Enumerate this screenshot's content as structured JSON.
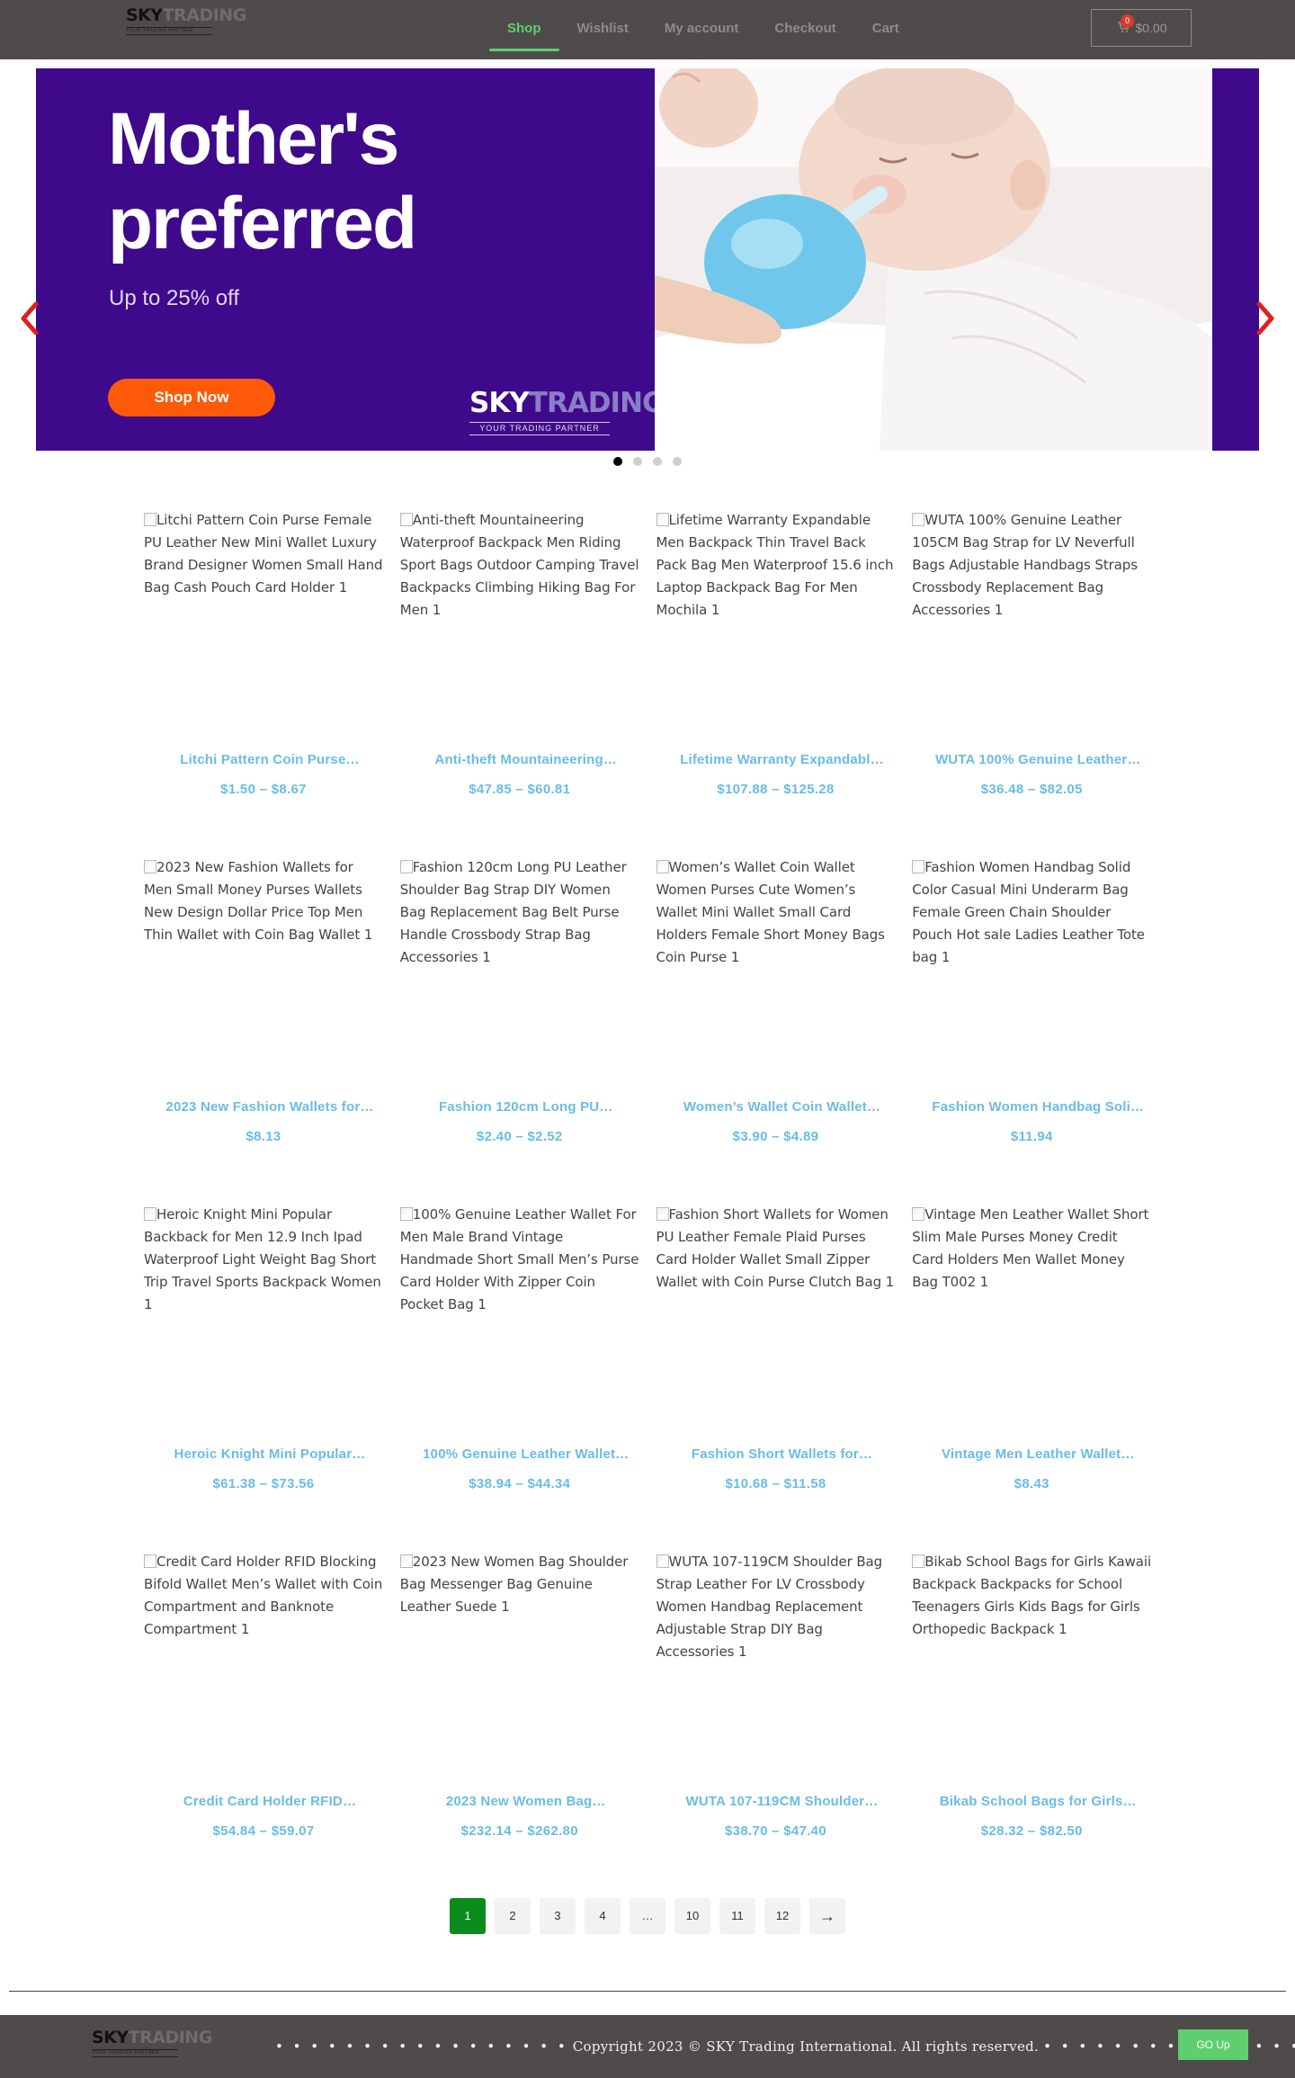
{
  "brand": {
    "logo_main": "SKY",
    "logo_accent": "TRADING",
    "logo_tagline": "YOUR TRADING PARTNER"
  },
  "nav": {
    "items": [
      {
        "label": "Shop",
        "active": true
      },
      {
        "label": "Wishlist",
        "active": false
      },
      {
        "label": "My account",
        "active": false
      },
      {
        "label": "Checkout",
        "active": false
      },
      {
        "label": "Cart",
        "active": false
      }
    ]
  },
  "cart": {
    "count": "0",
    "amount": "$0.00",
    "icon": "cart-icon"
  },
  "banner": {
    "headline_line1": "Mother's",
    "headline_line2": "preferred",
    "subline": "Up to 25% off",
    "cta": "Shop Now",
    "brand_main": "SKY",
    "brand_accent": "TRADING",
    "brand_tagline": "YOUR TRADING PARTNER",
    "background_color": "#3e098a",
    "slide_count": 4,
    "active_slide": 1
  },
  "products": [
    {
      "alt": "Litchi Pattern Coin Purse Female PU Leather New Mini Wallet Luxury Brand Designer Women Small Hand Bag Cash Pouch Card Holder 1",
      "title": "Litchi Pattern Coin Purse…",
      "price": "$1.50 – $8.67"
    },
    {
      "alt": "Anti-theft Mountaineering Waterproof Backpack Men Riding Sport Bags Outdoor Camping Travel Backpacks Climbing Hiking Bag For Men 1",
      "title": "Anti-theft Mountaineering…",
      "price": "$47.85 – $60.81"
    },
    {
      "alt": "Lifetime Warranty Expandable Men Backpack Thin Travel Back Pack Bag Men Waterproof 15.6 inch Laptop Backpack Bag For Men Mochila 1",
      "title": "Lifetime Warranty Expandabl…",
      "price": "$107.88 – $125.28"
    },
    {
      "alt": "WUTA 100% Genuine Leather 105CM Bag Strap for LV Neverfull Bags Adjustable Handbags Straps Crossbody Replacement Bag Accessories 1",
      "title": "WUTA 100% Genuine Leather…",
      "price": "$36.48 – $82.05"
    },
    {
      "alt": "2023 New Fashion Wallets for Men Small Money Purses Wallets New Design Dollar Price Top Men Thin Wallet with Coin Bag Wallet 1",
      "title": "2023 New Fashion Wallets for…",
      "price": "$8.13"
    },
    {
      "alt": "Fashion 120cm Long PU Leather Shoulder Bag Strap DIY Women Bag Replacement Bag Belt Purse Handle Crossbody Strap Bag Accessories 1",
      "title": "Fashion 120cm Long PU…",
      "price": "$2.40 – $2.52"
    },
    {
      "alt": "Women’s Wallet Coin Wallet Women Purses Cute Women’s Wallet Mini Wallet Small Card Holders Female Short Money Bags Coin Purse 1",
      "title": "Women’s Wallet Coin Wallet…",
      "price": "$3.90 – $4.89"
    },
    {
      "alt": "Fashion Women Handbag Solid Color Casual Mini Underarm Bag Female Green Chain Shoulder Pouch Hot sale Ladies Leather Tote bag 1",
      "title": "Fashion Women Handbag Soli…",
      "price": "$11.94"
    },
    {
      "alt": "Heroic Knight Mini Popular Backback for Men 12.9 Inch Ipad Waterproof Light Weight Bag Short Trip Travel Sports Backpack Women 1",
      "title": "Heroic Knight Mini Popular…",
      "price": "$61.38 – $73.56"
    },
    {
      "alt": "100% Genuine Leather Wallet For Men Male Brand Vintage Handmade Short Small Men’s Purse Card Holder With Zipper Coin Pocket Bag 1",
      "title": "100% Genuine Leather Wallet…",
      "price": "$38.94 – $44.34"
    },
    {
      "alt": "Fashion Short Wallets for Women PU Leather Female Plaid Purses Card Holder Wallet Small Zipper Wallet with Coin Purse Clutch Bag 1",
      "title": "Fashion Short Wallets for…",
      "price": "$10.68 – $11.58"
    },
    {
      "alt": "Vintage Men Leather Wallet Short Slim Male Purses Money Credit Card Holders Men Wallet Money Bag T002 1",
      "title": "Vintage Men Leather Wallet…",
      "price": "$8.43"
    },
    {
      "alt": "Credit Card Holder RFID Blocking Bifold Wallet Men’s Wallet with Coin Compartment and Banknote Compartment 1",
      "title": "Credit Card Holder RFID…",
      "price": "$54.84 – $59.07"
    },
    {
      "alt": "2023 New Women Bag Shoulder Bag Messenger Bag Genuine Leather Suede 1",
      "title": "2023 New Women Bag…",
      "price": "$232.14 – $262.80"
    },
    {
      "alt": "WUTA 107-119CM Shoulder Bag Strap Leather For LV Crossbody Women Handbag Replacement Adjustable Strap DIY Bag Accessories 1",
      "title": "WUTA 107-119CM Shoulder…",
      "price": "$38.70 – $47.40"
    },
    {
      "alt": "Bikab School Bags for Girls Kawaii Backpack Backpacks for School Teenagers Girls Kids Bags for Girls Orthopedic Backpack 1",
      "title": "Bikab School Bags for Girls…",
      "price": "$28.32 – $82.50"
    }
  ],
  "pagination": {
    "pages": [
      "1",
      "2",
      "3",
      "4",
      "…",
      "10",
      "11",
      "12",
      "→"
    ],
    "current": "1"
  },
  "footer": {
    "dots_left": "• • • • • • • • • • • • • • • • •",
    "copyright": "Copyright 2023 © SKY Trading International. All rights reserved.",
    "dots_right": "• • • • • • • • • • • • • • • • •",
    "go_up": "GO Up"
  },
  "colors": {
    "header_bg": "#504b4b",
    "accent_green": "#5fce6e",
    "product_text": "#69bce7",
    "current_page": "#0a8c1c"
  }
}
